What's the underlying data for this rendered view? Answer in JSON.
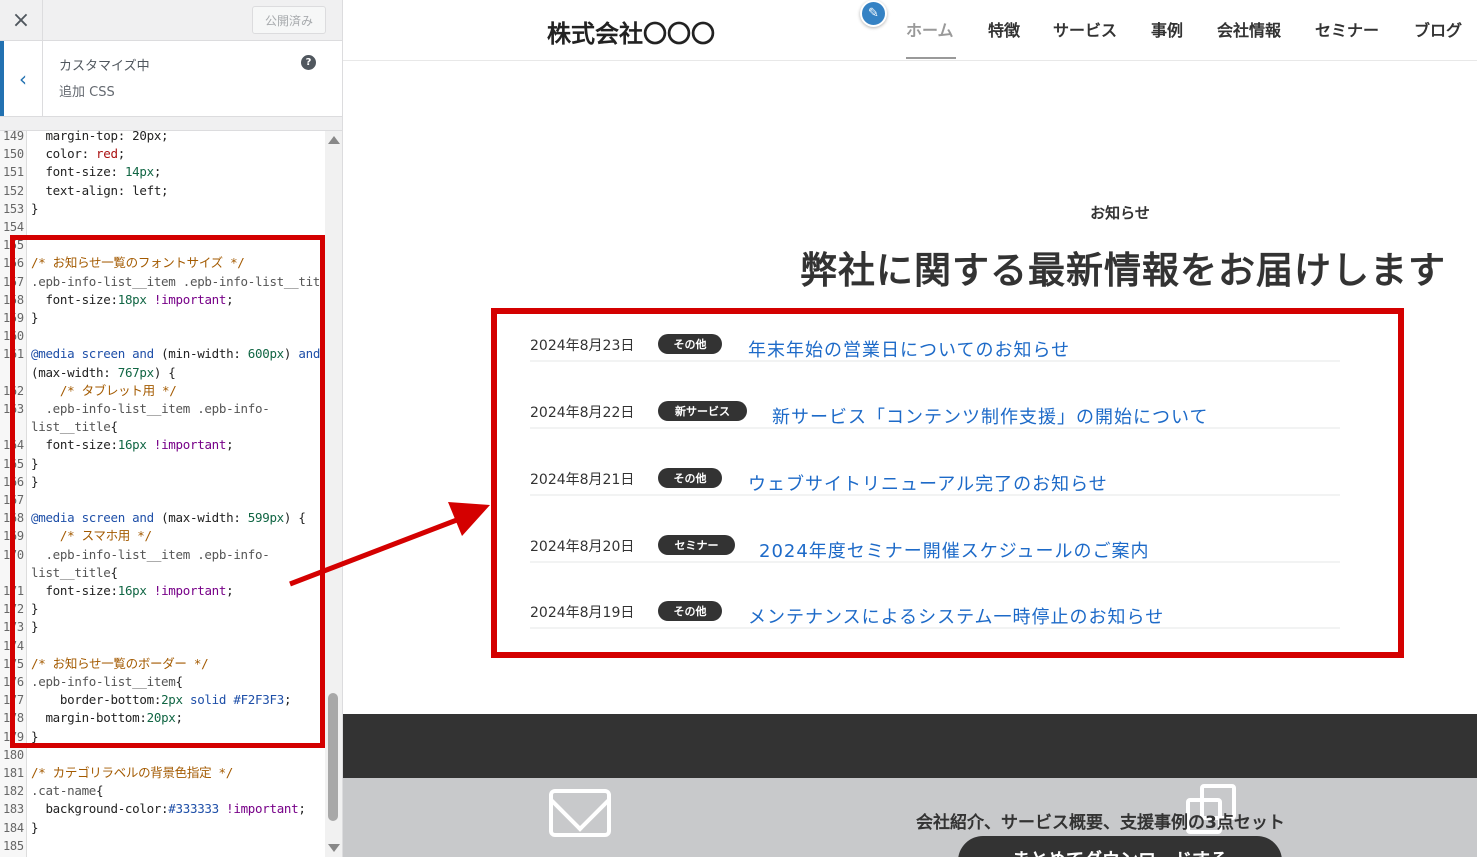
{
  "customizer": {
    "close_icon": "×",
    "publish_label": "公開済み",
    "back_icon": "‹",
    "customizing_label": "カスタマイズ中",
    "section_title": "追加 CSS",
    "help_icon": "?",
    "code_lines": [
      {
        "n": "149",
        "html": "  margin-top: 20px;"
      },
      {
        "n": "150",
        "html": "  color: <span class='c-red'>red</span>;"
      },
      {
        "n": "151",
        "html": "  font-size: <span class='c-num'>14px</span>;"
      },
      {
        "n": "152",
        "html": "  text-align: left;"
      },
      {
        "n": "153",
        "html": "}"
      },
      {
        "n": "154",
        "html": ""
      },
      {
        "n": "155",
        "html": ""
      },
      {
        "n": "156",
        "html": "<span class='c-comment'>/* お知らせ一覧のフォントサイズ */</span>"
      },
      {
        "n": "157",
        "html": "<span class='c-sel'>.epb-info-list__item .epb-info-list__title</span>{"
      },
      {
        "n": "158",
        "html": "  font-size:<span class='c-num'>18px</span> <span class='c-imp'>!important</span>;"
      },
      {
        "n": "159",
        "html": "}"
      },
      {
        "n": "160",
        "html": ""
      },
      {
        "n": "161",
        "html": "<span class='c-kw'>@media screen and</span> (min-width: <span class='c-num'>600px</span>) <span class='c-kw'>and</span>"
      },
      {
        "n": "",
        "html": "(max-width: <span class='c-num'>767px</span>) {"
      },
      {
        "n": "162",
        "html": "    <span class='c-comment'>/* タブレット用 */</span>"
      },
      {
        "n": "163",
        "html": "  <span class='c-sel'>.epb-info-list__item .epb-info-</span>"
      },
      {
        "n": "",
        "html": "<span class='c-sel'>list__title</span>{"
      },
      {
        "n": "164",
        "html": "  font-size:<span class='c-num'>16px</span> <span class='c-imp'>!important</span>;"
      },
      {
        "n": "165",
        "html": "}"
      },
      {
        "n": "166",
        "html": "}"
      },
      {
        "n": "167",
        "html": ""
      },
      {
        "n": "168",
        "html": "<span class='c-kw'>@media screen and</span> (max-width: <span class='c-num'>599px</span>) {"
      },
      {
        "n": "169",
        "html": "    <span class='c-comment'>/* スマホ用 */</span>"
      },
      {
        "n": "170",
        "html": "  <span class='c-sel'>.epb-info-list__item .epb-info-</span>"
      },
      {
        "n": "",
        "html": "<span class='c-sel'>list__title</span>{"
      },
      {
        "n": "171",
        "html": "  font-size:<span class='c-num'>16px</span> <span class='c-imp'>!important</span>;"
      },
      {
        "n": "172",
        "html": "}"
      },
      {
        "n": "173",
        "html": "}"
      },
      {
        "n": "174",
        "html": ""
      },
      {
        "n": "175",
        "html": "<span class='c-comment'>/* お知らせ一覧のボーダー */</span>"
      },
      {
        "n": "176",
        "html": "<span class='c-sel'>.epb-info-list__item</span>{"
      },
      {
        "n": "177",
        "html": "    border-bottom:<span class='c-num'>2px</span> <span class='c-kw'>solid</span> <span class='c-kw'>#F2F3F3</span>;"
      },
      {
        "n": "178",
        "html": "  margin-bottom:<span class='c-num'>20px</span>;"
      },
      {
        "n": "179",
        "html": "}"
      },
      {
        "n": "180",
        "html": ""
      },
      {
        "n": "181",
        "html": "<span class='c-comment'>/* カテゴリラベルの背景色指定 */</span>"
      },
      {
        "n": "182",
        "html": "<span class='c-sel'>.cat-name</span>{"
      },
      {
        "n": "183",
        "html": "  background-color:<span class='c-kw'>#333333</span> <span class='c-imp'>!important</span>;"
      },
      {
        "n": "184",
        "html": "}"
      },
      {
        "n": "185",
        "html": ""
      }
    ]
  },
  "site": {
    "logo": "株式会社〇〇〇",
    "edit_icon": "✎",
    "nav": [
      "ホーム",
      "特徴",
      "サービス",
      "事例",
      "会社情報",
      "セミナー",
      "ブログ"
    ],
    "news_eyebrow": "お知らせ",
    "news_heading": "弊社に関する最新情報をお届けします",
    "news": [
      {
        "date": "2024年8月23日",
        "category": "その他",
        "title": "年末年始の営業日についてのお知らせ"
      },
      {
        "date": "2024年8月22日",
        "category": "新サービス",
        "title": "新サービス「コンテンツ制作支援」の開始について"
      },
      {
        "date": "2024年8月21日",
        "category": "その他",
        "title": "ウェブサイトリニューアル完了のお知らせ"
      },
      {
        "date": "2024年8月20日",
        "category": "セミナー",
        "title": "2024年度セミナー開催スケジュールのご案内"
      },
      {
        "date": "2024年8月19日",
        "category": "その他",
        "title": "メンテナンスによるシステム一時停止のお知らせ"
      }
    ],
    "cta_text": "会社紹介、サービス概要、支援事例の3点セット",
    "cta_button": "まとめてダウンロードする"
  },
  "colors": {
    "annotation": "#d40000",
    "link": "#1d6ac8",
    "category_bg": "#333333",
    "accent": "#2271b1"
  }
}
